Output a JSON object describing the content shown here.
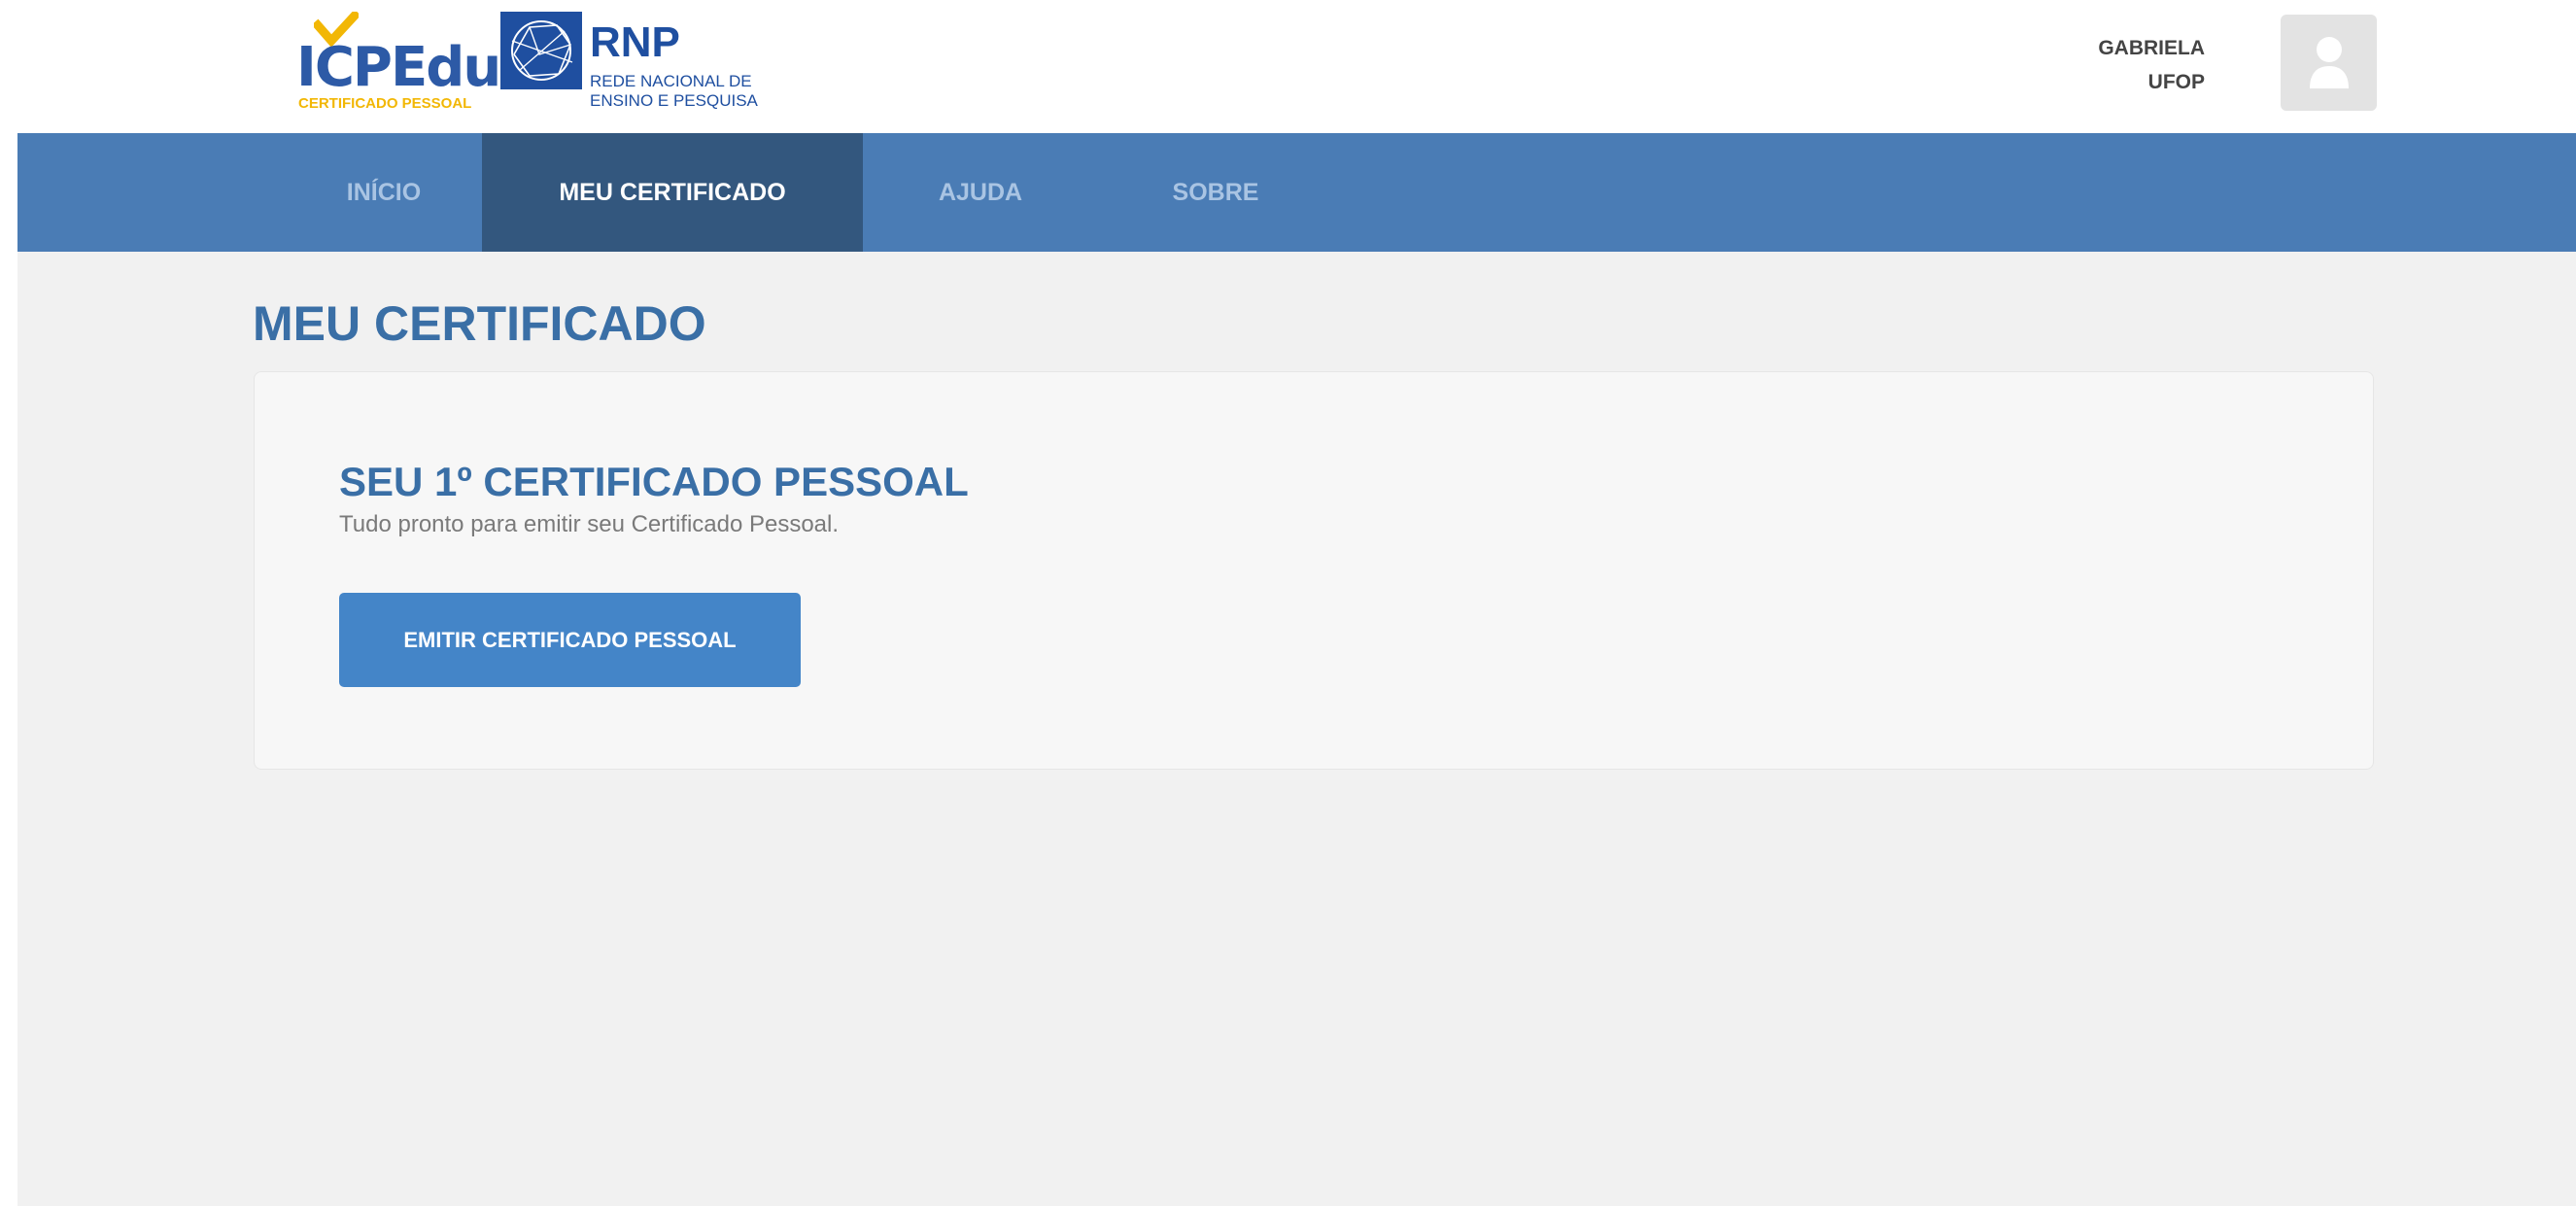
{
  "header": {
    "logo_icpedu": {
      "text": "ICPEdu",
      "subtitle": "CERTIFICADO PESSOAL"
    },
    "logo_rnp": {
      "text": "RNP",
      "subtitle_line1": "REDE NACIONAL DE",
      "subtitle_line2": "ENSINO E PESQUISA"
    },
    "user": {
      "name": "GABRIELA",
      "institution": "UFOP"
    },
    "avatar_icon": "user-silhouette-icon"
  },
  "nav": {
    "items": [
      {
        "label": "INÍCIO",
        "active": false
      },
      {
        "label": "MEU CERTIFICADO",
        "active": true
      },
      {
        "label": "AJUDA",
        "active": false
      },
      {
        "label": "SOBRE",
        "active": false
      }
    ]
  },
  "main": {
    "page_title": "MEU CERTIFICADO",
    "card": {
      "title": "SEU 1º CERTIFICADO PESSOAL",
      "subtitle": "Tudo pronto para emitir seu Certificado Pessoal.",
      "button_label": "EMITIR CERTIFICADO PESSOAL"
    }
  },
  "colors": {
    "nav_bg": "#4a7cb5",
    "nav_active_bg": "#33577e",
    "title_blue": "#3a6fa6",
    "button_blue": "#4485c8",
    "icpedu_yellow": "#f2b705",
    "rnp_blue": "#1f4fa0"
  }
}
